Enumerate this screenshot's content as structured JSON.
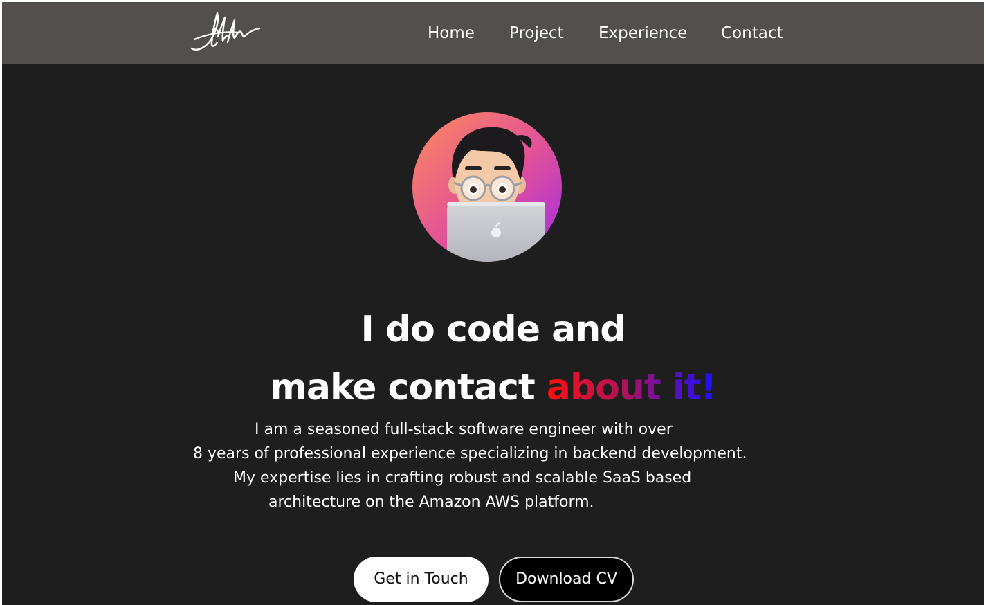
{
  "nav": {
    "items": [
      {
        "label": "Home"
      },
      {
        "label": "Project"
      },
      {
        "label": "Experience"
      },
      {
        "label": "Contact"
      }
    ]
  },
  "hero": {
    "line1": "I do code and",
    "line2_plain": "make contact",
    "line2_gradient": "about it!",
    "bio": [
      "I am a seasoned full-stack software engineer with over",
      "8 years of professional experience specializing in backend development.",
      "My expertise lies in crafting robust and scalable SaaS based",
      "architecture on the Amazon AWS platform."
    ]
  },
  "buttons": {
    "primary": "Get in Touch",
    "secondary": "Download CV"
  },
  "colors": {
    "page_bg": "#1f1e1e",
    "nav_bg": "#524f4e",
    "gradient_start": "#ff1010",
    "gradient_end": "#1a10ff"
  },
  "icons": {
    "logo": "signature-logo",
    "avatar": "memoji-avatar-with-laptop"
  }
}
